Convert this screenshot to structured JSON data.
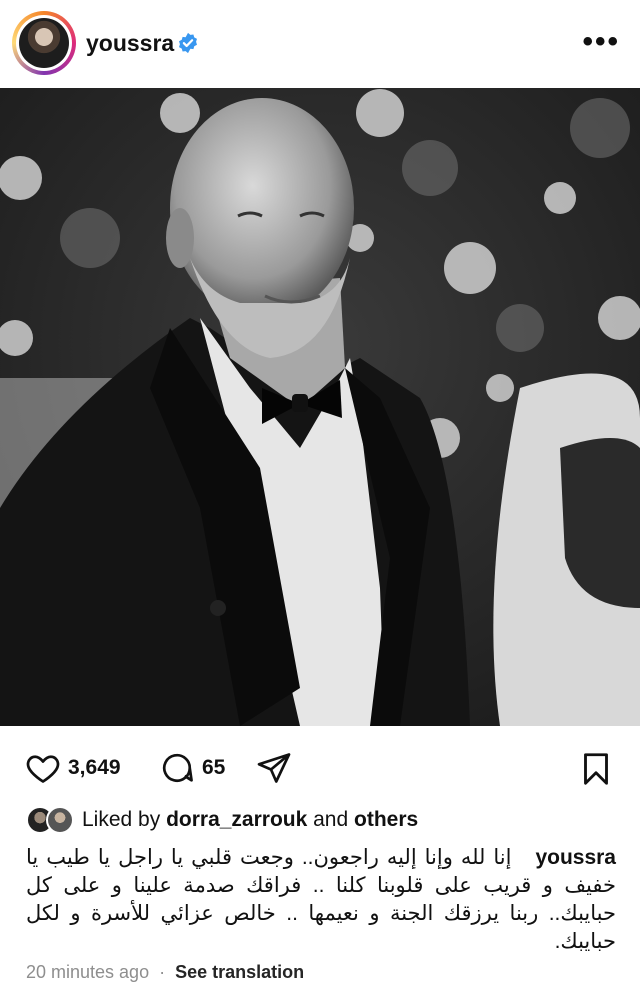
{
  "post": {
    "username": "youssra",
    "likes_count": "3,649",
    "comments_count": "65",
    "liked_by_prefix": "Liked by",
    "liked_by_user": "dorra_zarrouk",
    "liked_by_and": "and",
    "liked_by_others": "others",
    "caption": "إنا لله وإنا إليه راجعون.. وجعت قلبي يا راجل يا طيب يا خفيف و قريب على قلوبنا كلنا .. فراقك صدمة علينا و على كل حبايبك.. ربنا يرزقك الجنة و نعيمها .. خالص عزائي للأسرة و لكل حبايبك.",
    "timestamp": "20 minutes ago",
    "separator": "·",
    "translate_label": "See translation"
  },
  "icons": {
    "verified": "verified-badge-icon",
    "more": "more-options-icon",
    "like": "heart-icon",
    "comment": "comment-bubble-icon",
    "share": "paper-plane-icon",
    "save": "bookmark-icon"
  },
  "colors": {
    "verified_blue": "#3897f0",
    "meta_gray": "#8e8e8e"
  }
}
